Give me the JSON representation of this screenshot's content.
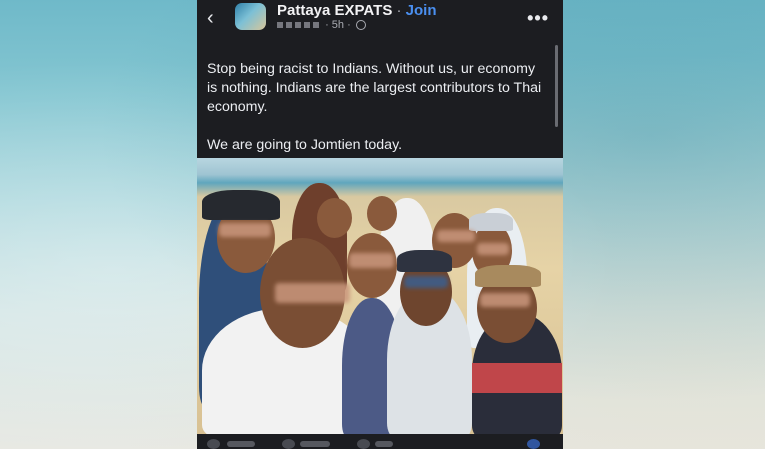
{
  "post": {
    "group_name": "Pattaya EXPATS",
    "separator": " · ",
    "join_label": "Join",
    "time": "5h",
    "text": "Stop being racist to Indians. Without us, ur economy is nothing. Indians are the largest contributors to Thai economy.\n\nWe are going to Jomtien today."
  },
  "icons": {
    "back": "chevron-left-icon",
    "more": "more-horizontal-icon",
    "privacy": "globe-icon"
  },
  "colors": {
    "post_background": "#1c1d21",
    "join_link": "#4a8ff0",
    "text": "#eceef2"
  }
}
